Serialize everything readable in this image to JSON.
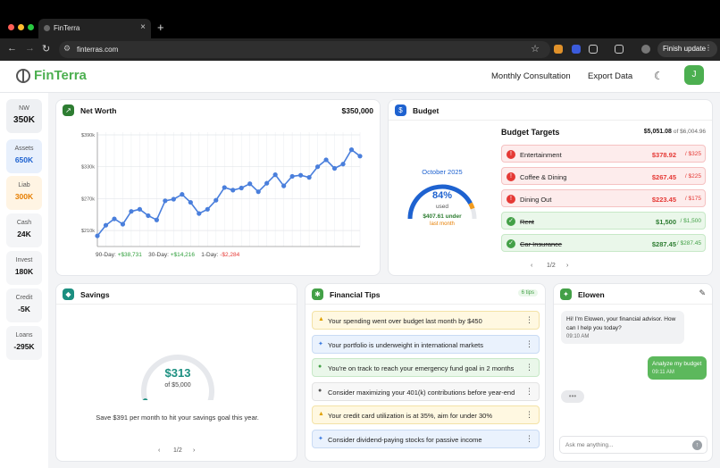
{
  "browser": {
    "tab_title": "FinTerra",
    "tab_close": "×",
    "new_tab": "+",
    "url": "finterras.com",
    "finish_update": "Finish update",
    "menu": "⋮"
  },
  "app": {
    "brand": "FinTerra",
    "nav": [
      "Monthly Consultation",
      "Export Data"
    ],
    "theme_icon": "moon-icon",
    "avatar_initial": "J"
  },
  "metrics": [
    {
      "label": "NW",
      "value": "350K",
      "color": "#111111"
    },
    {
      "label": "Assets",
      "value": "650K",
      "color": "#1e62d0"
    },
    {
      "label": "Liab",
      "value": "300K",
      "color": "#e67e00"
    },
    {
      "label": "Cash",
      "value": "24K",
      "color": "#111111"
    },
    {
      "label": "Invest",
      "value": "180K",
      "color": "#111111"
    },
    {
      "label": "Credit",
      "value": "-5K",
      "color": "#111111"
    },
    {
      "label": "Loans",
      "value": "-295K",
      "color": "#111111"
    }
  ],
  "net_worth": {
    "title": "Net Worth",
    "total": "$350,000",
    "changes": {
      "d90_label": "90-Day:",
      "d90_value": "+$38,731",
      "d30_label": "30-Day:",
      "d30_value": "+$14,216",
      "d1_label": "1-Day:",
      "d1_value": "-$2,284"
    }
  },
  "chart_data": {
    "type": "line",
    "title": "",
    "ylabel": "",
    "xlabel": "",
    "y_ticks": [
      "$210k",
      "$270k",
      "$330k",
      "$390k"
    ],
    "y_tick_values": [
      210,
      270,
      330,
      390
    ],
    "ylim": [
      180,
      395
    ],
    "grid": true,
    "series": [
      {
        "color": "#4a7fdc",
        "values": [
          200,
          220,
          232,
          222,
          246,
          250,
          238,
          230,
          266,
          269,
          278,
          263,
          242,
          250,
          267,
          291,
          286,
          290,
          298,
          283,
          299,
          315,
          294,
          312,
          314,
          310,
          330,
          343,
          327,
          335,
          362,
          350
        ]
      }
    ],
    "units": "$k"
  },
  "budget": {
    "title": "Budget",
    "month": "October 2025",
    "percent": "84%",
    "percent_value": 0.84,
    "used_label": "used",
    "under_text": "$407.61 under",
    "last_month": "last month",
    "targets_title": "Budget Targets",
    "targets_total": "$5,051.08",
    "targets_of": "of $6,004.96",
    "items": [
      {
        "name": "Entertainment",
        "amount": "$378.92",
        "limit": "/ $325",
        "status": "over"
      },
      {
        "name": "Coffee & Dining",
        "amount": "$267.45",
        "limit": "/ $225",
        "status": "over"
      },
      {
        "name": "Dining Out",
        "amount": "$223.45",
        "limit": "/ $175",
        "status": "over"
      },
      {
        "name": "Rent",
        "amount": "$1,500",
        "limit": "/ $1,500",
        "status": "ok"
      },
      {
        "name": "Car Insurance",
        "amount": "$287.45",
        "limit": "/ $287.45",
        "status": "ok"
      }
    ],
    "pager": {
      "prev": "‹",
      "page": "1/2",
      "next": "›"
    }
  },
  "savings": {
    "title": "Savings",
    "amount": "$313",
    "of": "of $5,000",
    "progress": 0.0626,
    "message": "Save $391 per month to hit your savings goal this year.",
    "pager": {
      "prev": "‹",
      "page": "1/2",
      "next": "›"
    }
  },
  "tips": {
    "title": "Financial Tips",
    "badge": "6 tips",
    "items": [
      {
        "text": "Your spending went over budget last month by $450",
        "kind": "warn",
        "icon": "▲",
        "icon_color": "#e0a100"
      },
      {
        "text": "Your portfolio is underweight in international markets",
        "kind": "info",
        "icon": "✦",
        "icon_color": "#3b7be0"
      },
      {
        "text": "You're on track to reach your emergency fund goal in 2 months",
        "kind": "good",
        "icon": "●",
        "icon_color": "#43a047"
      },
      {
        "text": "Consider maximizing your 401(k) contributions before year-end",
        "kind": "neut",
        "icon": "●",
        "icon_color": "#555555"
      },
      {
        "text": "Your credit card utilization is at 35%, aim for under 30%",
        "kind": "warn",
        "icon": "▲",
        "icon_color": "#e0a100"
      },
      {
        "text": "Consider dividend-paying stocks for passive income",
        "kind": "info",
        "icon": "✦",
        "icon_color": "#3b7be0"
      }
    ],
    "more_icon": "⋮"
  },
  "chat": {
    "title": "Elowen",
    "edit_icon": "✎",
    "messages": [
      {
        "from": "assistant",
        "text": "Hi! I'm Elowen, your financial advisor. How can I help you today?",
        "time": "09:10 AM"
      },
      {
        "from": "user",
        "text": "Analyze my budget",
        "time": "09:11 AM"
      }
    ],
    "typing": "•••",
    "placeholder": "Ask me anything...",
    "send_icon": "↑"
  },
  "colors": {
    "brand_green": "#4caf50",
    "chart_blue": "#4a7fdc",
    "positive": "#2e9e3a",
    "negative": "#e53935"
  }
}
